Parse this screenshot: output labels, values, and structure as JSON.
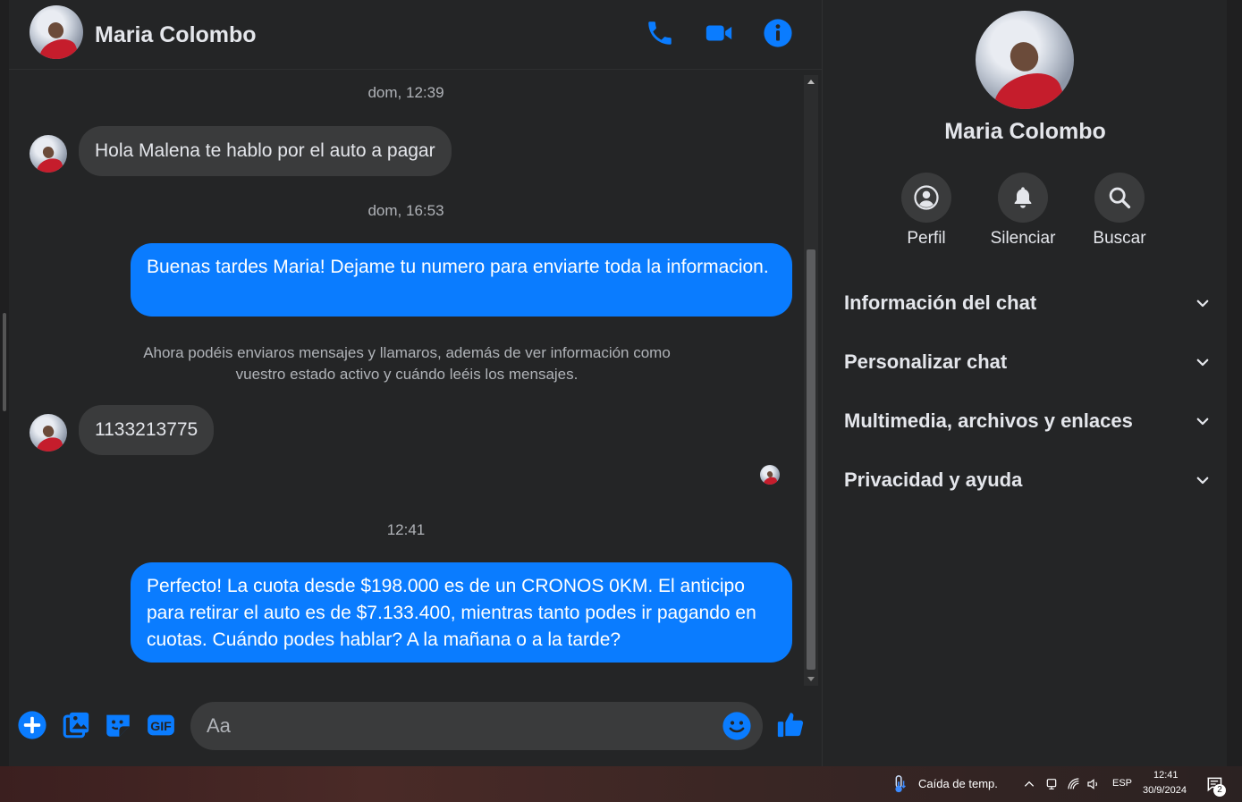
{
  "header": {
    "contact_name": "Maria Colombo",
    "icons": [
      "phone-icon",
      "video-camera-icon",
      "info-icon"
    ]
  },
  "conversation": {
    "timestamp_1": "dom, 12:39",
    "msg_1": "Hola Malena te hablo por el auto a pagar",
    "timestamp_2": "dom, 16:53",
    "msg_2": "Buenas tardes Maria! Dejame tu numero para enviarte toda la informacion.",
    "notice": "Ahora podéis enviaros mensajes y llamaros, además de ver información como vuestro estado activo y cuándo leéis los mensajes.",
    "msg_3": "1133213775",
    "timestamp_3": "12:41",
    "msg_4": "Perfecto! La cuota desde $198.000 es de un CRONOS 0KM. El anticipo para retirar el auto es de $7.133.400, mientras tanto podes ir pagando en cuotas. Cuándo podes hablar? A la mañana o a la tarde?"
  },
  "composer": {
    "placeholder": "Aa",
    "icons": [
      "plus-icon",
      "image-icon",
      "sticker-icon",
      "gif-icon",
      "emoji-icon",
      "thumbs-up-icon"
    ]
  },
  "panel": {
    "contact_name": "Maria Colombo",
    "actions": [
      {
        "label": "Perfil",
        "icon": "profile-icon"
      },
      {
        "label": "Silenciar",
        "icon": "bell-icon"
      },
      {
        "label": "Buscar",
        "icon": "search-icon"
      }
    ],
    "sections": [
      "Información del chat",
      "Personalizar chat",
      "Multimedia, archivos y enlaces",
      "Privacidad y ayuda"
    ]
  },
  "taskbar": {
    "weather": "Caída de temp.",
    "language": "ESP",
    "time": "12:41",
    "date": "30/9/2024",
    "notification_count": "2"
  },
  "colors": {
    "accent": "#0a7cff",
    "background": "#242526",
    "incoming_bubble": "#3a3b3c"
  }
}
